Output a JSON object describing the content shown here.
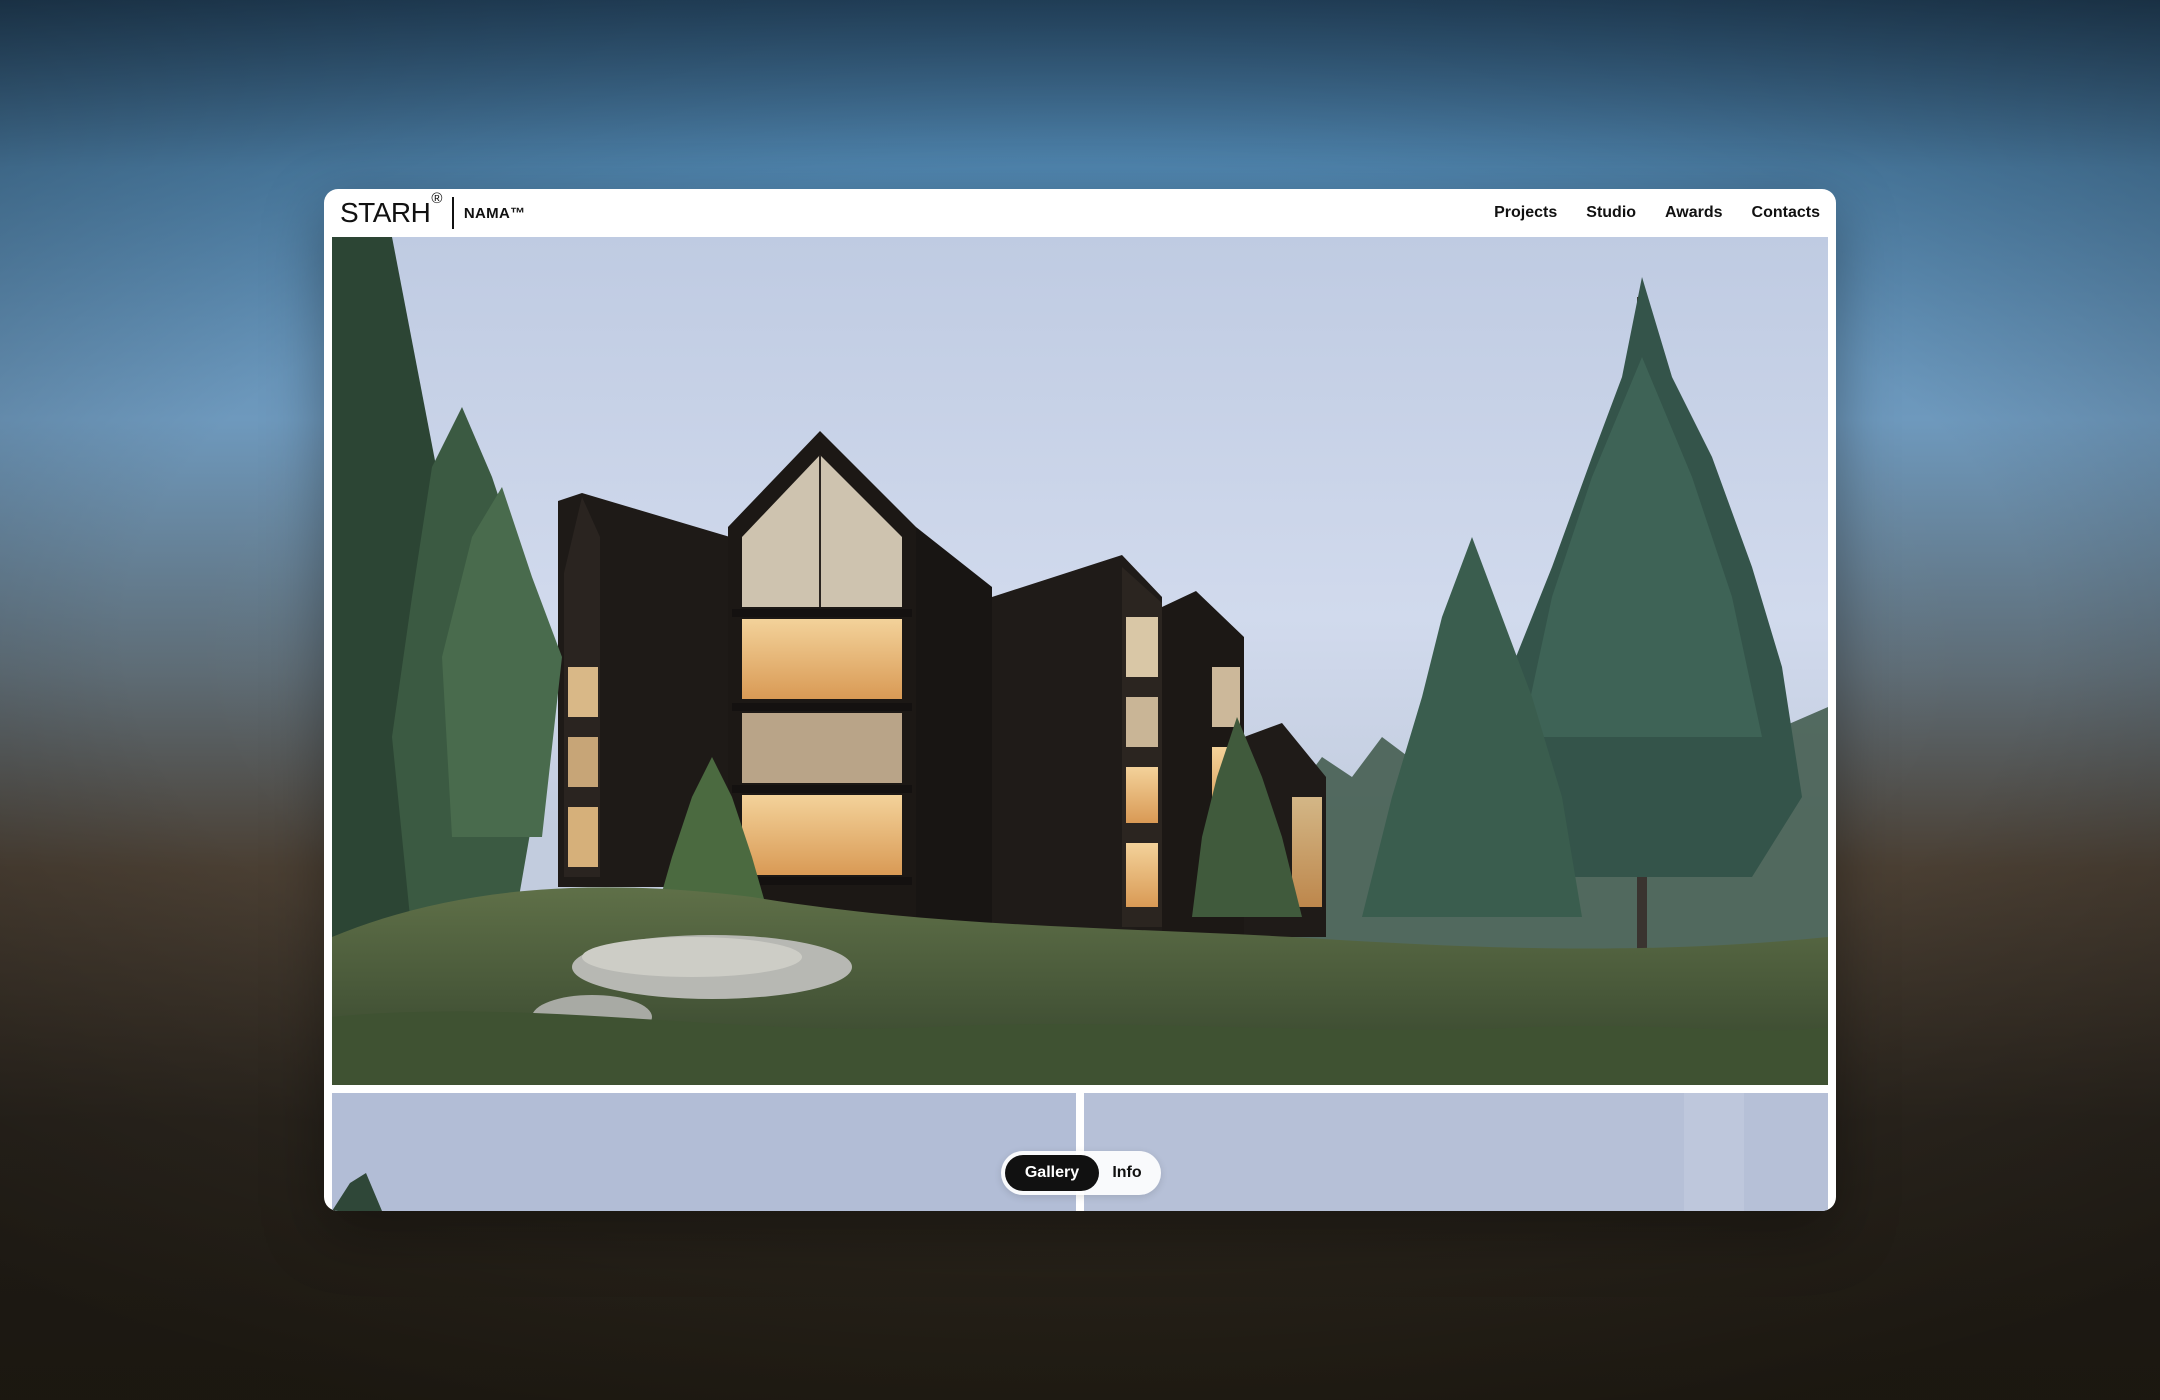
{
  "brand": {
    "name": "STARH",
    "mark": "®",
    "project": "NAMA™"
  },
  "nav": {
    "items": [
      "Projects",
      "Studio",
      "Awards",
      "Contacts"
    ]
  },
  "view_toggle": {
    "active": "Gallery",
    "inactive": "Info"
  },
  "colors": {
    "accent": "#111111",
    "window_bg": "#ffffff",
    "sky": "#c8d2e6",
    "wood": "#1f1b18",
    "warm_light": "#e8b573",
    "pine": "#2e4a3b"
  },
  "icons": [
    "registered-mark-icon"
  ]
}
